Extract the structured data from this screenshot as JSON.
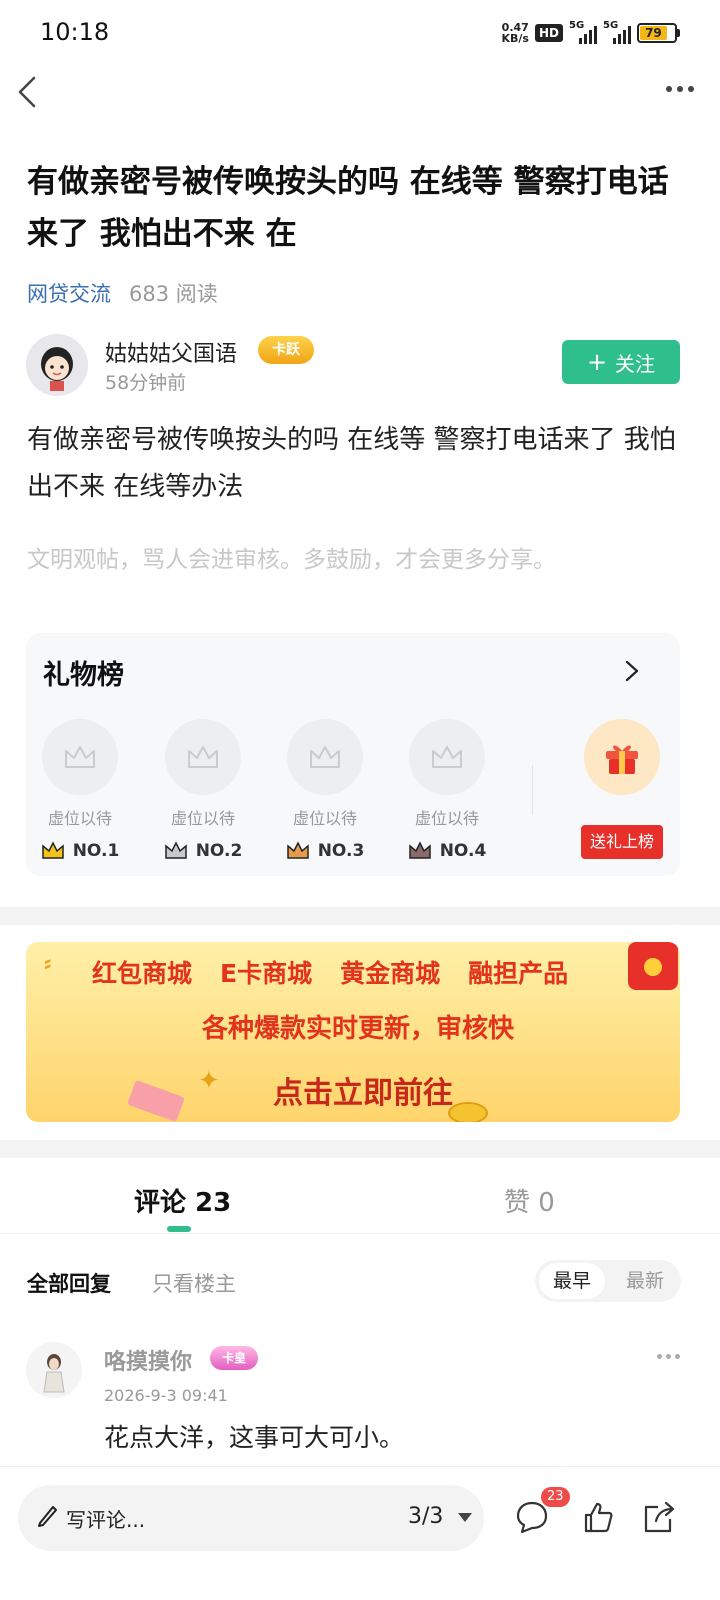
{
  "status": {
    "time": "10:18",
    "net_speed_value": "0.47",
    "net_speed_unit": "KB/s",
    "hd": "HD",
    "sim1": "5G",
    "sim2": "5G",
    "battery": "79"
  },
  "nav": {
    "back_icon": "chevron-left-icon",
    "more_icon": "more-horizontal-icon"
  },
  "post": {
    "title": "有做亲密号被传唤按头的吗 在线等 警察打电话来了 我怕出不来 在",
    "forum": "网贷交流",
    "reads": "683 阅读",
    "body": "有做亲密号被传唤按头的吗 在线等 警察打电话来了 我怕出不来 在线等办法",
    "civility_notice": "文明观帖，骂人会进审核。多鼓励，才会更多分享。"
  },
  "author": {
    "name": "姑姑姑父国语",
    "badge": "卡跃",
    "time": "58分钟前",
    "follow_label": "关注"
  },
  "gift_board": {
    "title": "礼物榜",
    "slots": [
      {
        "placeholder": "虚位以待",
        "rank": "NO.1",
        "color": "#f3c21b"
      },
      {
        "placeholder": "虚位以待",
        "rank": "NO.2",
        "color": "#c7c9cf"
      },
      {
        "placeholder": "虚位以待",
        "rank": "NO.3",
        "color": "#e69a4d"
      },
      {
        "placeholder": "虚位以待",
        "rank": "NO.4",
        "color": "#8a6a6a"
      }
    ],
    "send_label": "送礼上榜"
  },
  "banner": {
    "items": [
      "红包商城",
      "E卡商城",
      "黄金商城",
      "融担产品"
    ],
    "subtitle": "各种爆款实时更新，审核快",
    "cta": "点击立即前往"
  },
  "tabs": {
    "comments": "评论 23",
    "likes": "赞 0"
  },
  "filters": {
    "all": "全部回复",
    "op_only": "只看楼主",
    "sort_early": "最早",
    "sort_new": "最新"
  },
  "comments": [
    {
      "name": "咯摸摸你",
      "badge": "卡皇",
      "time": "2026-9-3 09:41",
      "text": "花点大洋，这事可大可小。"
    }
  ],
  "bottom": {
    "write_placeholder": "写评论...",
    "page": "3/3",
    "comment_badge": "23"
  },
  "colors": {
    "accent": "#2fbf8c",
    "link": "#3a6fb0",
    "send_red": "#e8302a"
  }
}
